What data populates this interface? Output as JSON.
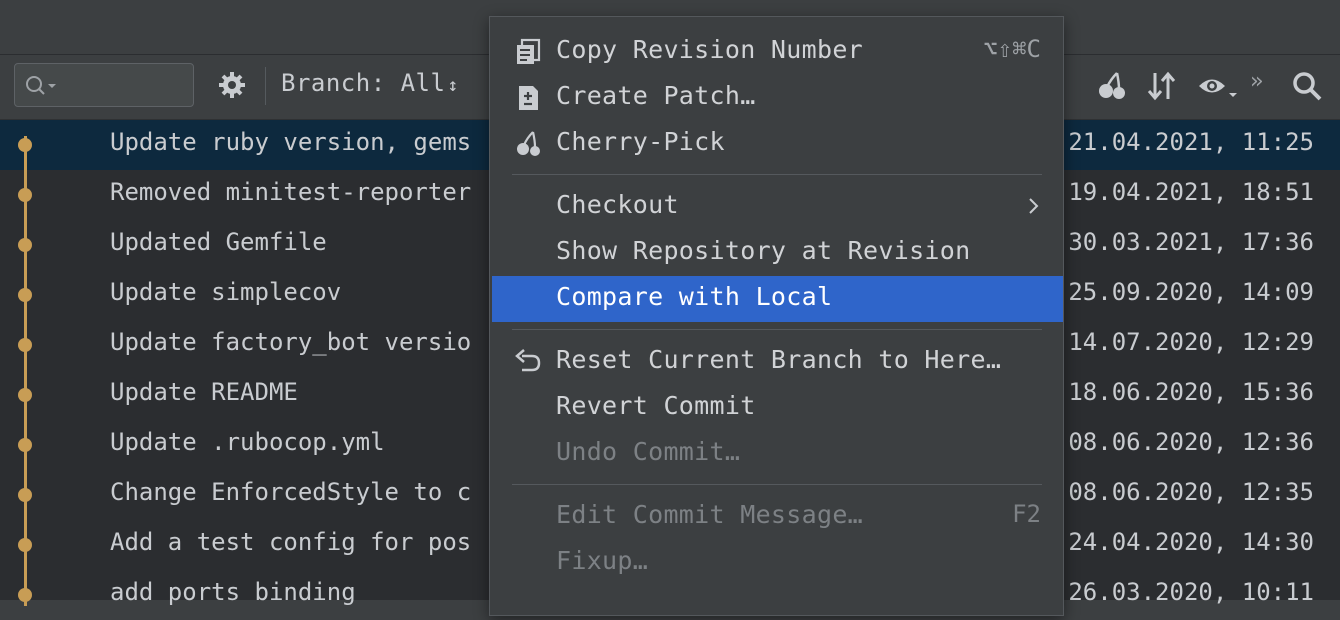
{
  "toolbar": {
    "branch_label": "Branch: All",
    "branch_arrows": "↕",
    "more": "»"
  },
  "commits": [
    {
      "message": "Update ruby version, gems",
      "date": "21.04.2021, 11:25"
    },
    {
      "message": "Removed minitest-reporter",
      "date": "19.04.2021, 18:51"
    },
    {
      "message": "Updated Gemfile",
      "date": "30.03.2021, 17:36"
    },
    {
      "message": "Update simplecov",
      "date": "25.09.2020, 14:09"
    },
    {
      "message": "Update factory_bot versio",
      "date": "14.07.2020, 12:29"
    },
    {
      "message": "Update README",
      "date": "18.06.2020, 15:36"
    },
    {
      "message": "Update .rubocop.yml",
      "date": "08.06.2020, 12:36"
    },
    {
      "message": "Change EnforcedStyle to c",
      "date": "08.06.2020, 12:35"
    },
    {
      "message": "Add a test config for pos",
      "date": "24.04.2020, 14:30"
    },
    {
      "message": "add ports binding",
      "date": "26.03.2020, 10:11"
    }
  ],
  "menu": {
    "copy_revision": {
      "label": "Copy Revision Number",
      "shortcut": "⌥⇧⌘C"
    },
    "create_patch": {
      "label": "Create Patch…"
    },
    "cherry_pick": {
      "label": "Cherry-Pick"
    },
    "checkout": {
      "label": "Checkout"
    },
    "show_repo": {
      "label": "Show Repository at Revision"
    },
    "compare_local": {
      "label": "Compare with Local"
    },
    "reset_branch": {
      "label": "Reset Current Branch to Here…"
    },
    "revert_commit": {
      "label": "Revert Commit"
    },
    "undo_commit": {
      "label": "Undo Commit…"
    },
    "edit_message": {
      "label": "Edit Commit Message…",
      "shortcut": "F2"
    },
    "fixup": {
      "label": "Fixup…"
    }
  },
  "colors": {
    "accent": "#2f65ca",
    "graph": "#c89d55",
    "selected_row": "#0d293e"
  }
}
